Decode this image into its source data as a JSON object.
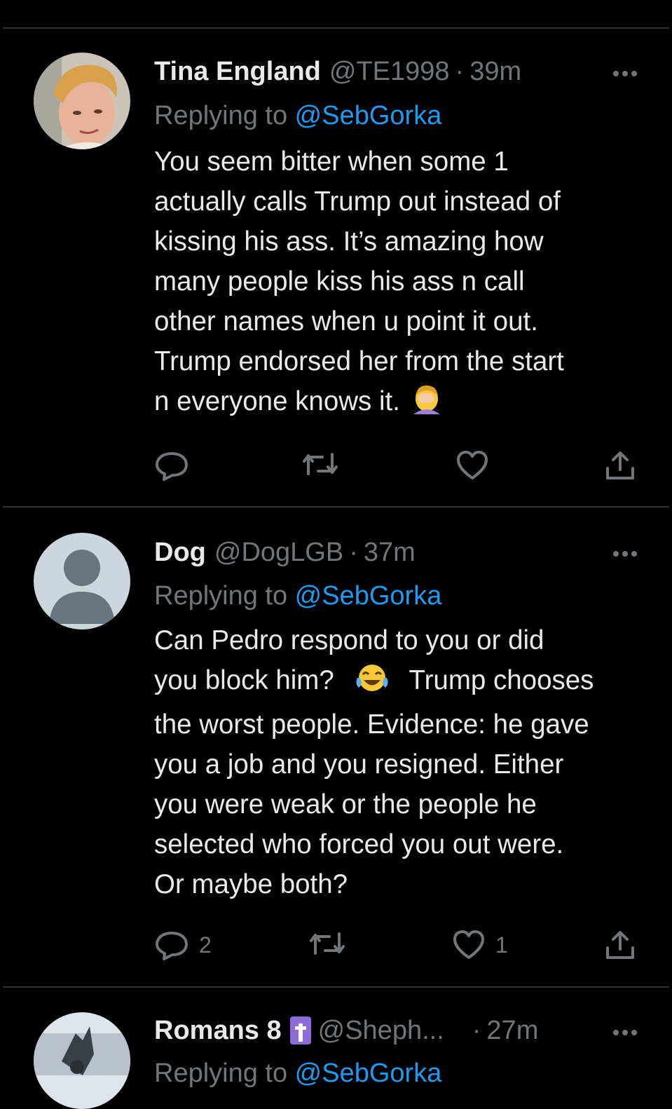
{
  "tweets": [
    {
      "name": "Tina England",
      "handle": "@TE1998",
      "time": "39m",
      "replying_prefix": "Replying to ",
      "replying_to": "@SebGorka",
      "lines": [
        "You seem bitter when some 1",
        "actually calls Trump out instead of",
        "kissing his ass. It’s amazing how",
        "many people kiss his ass n call",
        "other names when u point it out.",
        "Trump endorsed her from the start",
        "n everyone knows it."
      ],
      "emoji": "face-palm",
      "reply_count": "",
      "like_count": ""
    },
    {
      "name": "Dog",
      "handle": "@DogLGB",
      "time": "37m",
      "replying_prefix": "Replying to ",
      "replying_to": "@SebGorka",
      "line1": "Can Pedro respond to you or did",
      "line2a": "you block him?",
      "line2b": "Trump chooses",
      "lines_rest": [
        "the worst people. Evidence: he gave",
        "you a job and you resigned. Either",
        "you were weak or the people he",
        "selected who forced you out were.",
        "Or maybe both?"
      ],
      "emoji": "tears-of-joy",
      "reply_count": "2",
      "like_count": "1"
    },
    {
      "name": "Romans 8",
      "handle": "@Sheph...",
      "time": "27m",
      "badge": "cross-emoji",
      "replying_prefix": "Replying to ",
      "replying_to": "@SebGorka"
    }
  ],
  "colors": {
    "background": "#000000",
    "text": "#e7e9ea",
    "muted": "#71767b",
    "link": "#1d9bf0",
    "divider": "#2f3336"
  }
}
